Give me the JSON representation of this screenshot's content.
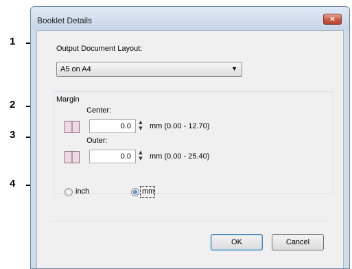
{
  "callouts": [
    "1",
    "2",
    "3",
    "4"
  ],
  "dialog": {
    "title": "Booklet Details",
    "close_icon": "×",
    "output_layout": {
      "label": "Output Document Layout:",
      "selected": "A5 on A4"
    },
    "margin": {
      "group_label": "Margin",
      "center": {
        "label": "Center:",
        "value": "0.0",
        "range": "mm (0.00 - 12.70)"
      },
      "outer": {
        "label": "Outer:",
        "value": "0.0",
        "range": "mm (0.00 - 25.40)"
      }
    },
    "units": {
      "inch_label": "inch",
      "mm_label": "mm",
      "selected": "mm"
    },
    "buttons": {
      "ok": "OK",
      "cancel": "Cancel"
    }
  }
}
